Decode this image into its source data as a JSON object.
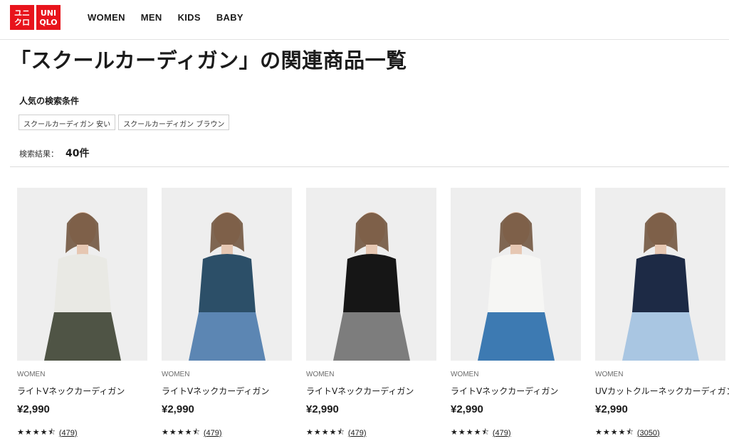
{
  "brand": {
    "logo_left": [
      "ユニ",
      "クロ"
    ],
    "logo_right": [
      "UNI",
      "QLO"
    ],
    "color": "#e8141c"
  },
  "nav": [
    "WOMEN",
    "MEN",
    "KIDS",
    "BABY"
  ],
  "page_title": "「スクールカーディガン」の関連商品一覧",
  "popular": {
    "label": "人気の検索条件",
    "chips": [
      "スクールカーディガン 安い",
      "スクールカーディガン ブラウン"
    ]
  },
  "results": {
    "label": "検索結果：",
    "count": "40件"
  },
  "products": [
    {
      "category": "WOMEN",
      "name": "ライトVネックカーディガン",
      "price": "¥2,990",
      "rating": 4.5,
      "reviews": "(479)",
      "garment_color": "#e9e9e4",
      "bottom_color": "#4f5445"
    },
    {
      "category": "WOMEN",
      "name": "ライトVネックカーディガン",
      "price": "¥2,990",
      "rating": 4.5,
      "reviews": "(479)",
      "garment_color": "#2c4f68",
      "bottom_color": "#5c86b3"
    },
    {
      "category": "WOMEN",
      "name": "ライトVネックカーディガン",
      "price": "¥2,990",
      "rating": 4.5,
      "reviews": "(479)",
      "garment_color": "#161616",
      "bottom_color": "#7d7d7d"
    },
    {
      "category": "WOMEN",
      "name": "ライトVネックカーディガン",
      "price": "¥2,990",
      "rating": 4.5,
      "reviews": "(479)",
      "garment_color": "#f6f6f4",
      "bottom_color": "#3d7ab2"
    },
    {
      "category": "WOMEN",
      "name": "UVカットクルーネックカーディガン",
      "price": "¥2,990",
      "rating": 4.5,
      "reviews": "(3050)",
      "garment_color": "#1d2a45",
      "bottom_color": "#a9c6e2"
    }
  ]
}
